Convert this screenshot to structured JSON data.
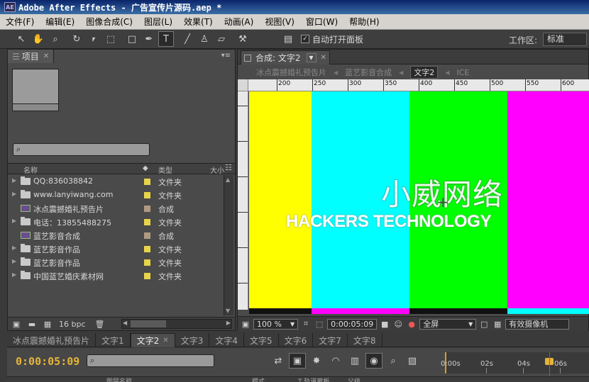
{
  "window": {
    "title": "Adobe After Effects - 广告宣传片源码.aep *",
    "logo": "AE"
  },
  "menu": [
    "文件(F)",
    "编辑(E)",
    "图像合成(C)",
    "图层(L)",
    "效果(T)",
    "动画(A)",
    "视图(V)",
    "窗口(W)",
    "帮助(H)"
  ],
  "toolbar": {
    "auto_open_label": "自动打开面板",
    "auto_open_checked": true,
    "workspace_label": "工作区:",
    "workspace_value": "标准"
  },
  "project": {
    "tab_label": "项目",
    "columns": {
      "name": "名称",
      "type": "类型",
      "size": "大小"
    },
    "items": [
      {
        "name": "QQ:836038842",
        "type": "文件夹",
        "kind": "folder",
        "label_color": "#e8d44a"
      },
      {
        "name": "www.lanyiwang.com",
        "type": "文件夹",
        "kind": "folder",
        "label_color": "#e8d44a"
      },
      {
        "name": "冰点震撼婚礼预告片",
        "type": "合成",
        "kind": "comp",
        "label_color": "#b09a80"
      },
      {
        "name": "电话：13855488275",
        "type": "文件夹",
        "kind": "folder",
        "label_color": "#e8d44a"
      },
      {
        "name": "蓝艺影音合成",
        "type": "合成",
        "kind": "comp",
        "label_color": "#b09a80"
      },
      {
        "name": "蓝艺影音作品",
        "type": "文件夹",
        "kind": "folder",
        "label_color": "#e8d44a"
      },
      {
        "name": "蓝艺影音作品",
        "type": "文件夹",
        "kind": "folder",
        "label_color": "#e8d44a"
      },
      {
        "name": "中国蓝艺婚庆素材网",
        "type": "文件夹",
        "kind": "folder",
        "label_color": "#e8d44a"
      }
    ],
    "bpc": "16 bpc"
  },
  "composition": {
    "tab_label": "合成: 文字2",
    "breadcrumbs": [
      "冰点震撼婚礼预告片",
      "蓝艺影音合成",
      "文字2",
      "ICE"
    ],
    "ruler_labels": [
      "200",
      "250",
      "300",
      "350",
      "400",
      "450",
      "500",
      "550",
      "600"
    ],
    "color_bars": [
      "#ffff00",
      "#00ffff",
      "#00ff00",
      "#ff00ff"
    ],
    "bottom_strip": [
      "#111111",
      "#ff00ff",
      "#111111",
      "#00ffff"
    ],
    "title_cn": "小威网络",
    "title_en": "HACKERS TECHNOLOGY",
    "zoom": "100 %",
    "timecode": "0:00:05:09",
    "resolution": "全屏",
    "camera": "有效摄像机"
  },
  "timeline": {
    "tabs": [
      "冰点震撼婚礼预告片",
      "文字1",
      "文字2",
      "文字3",
      "文字4",
      "文字5",
      "文字6",
      "文字7",
      "文字8"
    ],
    "active_tab": "文字2",
    "timecode": "0:00:05:09",
    "ruler_labels": [
      "0:00s",
      "02s",
      "04s",
      "06s"
    ],
    "layer_columns": {
      "name": "图层名称",
      "mode": "模式",
      "trkmat": "T 轨道蒙板",
      "parent": "父级"
    }
  }
}
